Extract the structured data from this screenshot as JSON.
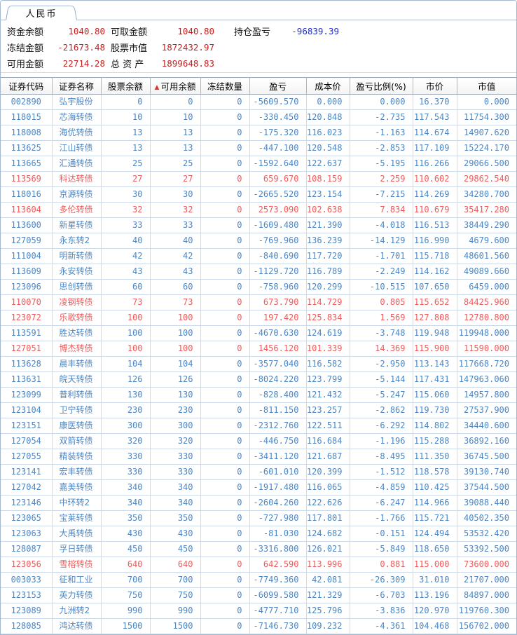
{
  "tab": {
    "label": "人民币"
  },
  "summary": {
    "funds_balance": {
      "label": "资金余额",
      "value": "1040.80"
    },
    "withdrawable": {
      "label": "可取金额",
      "value": "1040.80"
    },
    "position_pnl": {
      "label": "持仓盈亏",
      "value": "-96839.39"
    },
    "frozen_amount": {
      "label": "冻结金额",
      "value": "-21673.48"
    },
    "stock_market_value": {
      "label": "股票市值",
      "value": "1872432.97"
    },
    "available_amount": {
      "label": "可用金额",
      "value": "22714.28"
    },
    "total_assets": {
      "label": "总 资 产",
      "value": "1899648.83"
    }
  },
  "colors": {
    "row_positive": "#f05a5a",
    "row_negative": "#4d86c2",
    "summary_value": "#c32222",
    "summary_pnl": "#2230cc",
    "sort_arrow": "#e23030"
  },
  "table": {
    "sort_icon": "up-triangle-icon",
    "sorted_column_index": 3,
    "sort_arrow_glyph": "▲",
    "columns": [
      "证券代码",
      "证券名称",
      "股票余额",
      "可用余额",
      "冻结数量",
      "盈亏",
      "成本价",
      "盈亏比例(%)",
      "市价",
      "市值"
    ],
    "rows": [
      [
        "002890",
        "弘宇股份",
        "0",
        "0",
        "0",
        "-5609.570",
        "0.000",
        "0.000",
        "16.370",
        "0.000",
        "blue"
      ],
      [
        "118015",
        "芯海转债",
        "10",
        "10",
        "0",
        "-330.450",
        "120.848",
        "-2.735",
        "117.543",
        "11754.300",
        "blue"
      ],
      [
        "118008",
        "海优转债",
        "13",
        "13",
        "0",
        "-175.320",
        "116.023",
        "-1.163",
        "114.674",
        "14907.620",
        "blue"
      ],
      [
        "113625",
        "江山转债",
        "13",
        "13",
        "0",
        "-447.100",
        "120.548",
        "-2.853",
        "117.109",
        "15224.170",
        "blue"
      ],
      [
        "113665",
        "汇通转债",
        "25",
        "25",
        "0",
        "-1592.640",
        "122.637",
        "-5.195",
        "116.266",
        "29066.500",
        "blue"
      ],
      [
        "113569",
        "科达转债",
        "27",
        "27",
        "0",
        "659.670",
        "108.159",
        "2.259",
        "110.602",
        "29862.540",
        "red"
      ],
      [
        "118016",
        "京源转债",
        "30",
        "30",
        "0",
        "-2665.520",
        "123.154",
        "-7.215",
        "114.269",
        "34280.700",
        "blue"
      ],
      [
        "113604",
        "多伦转债",
        "32",
        "32",
        "0",
        "2573.090",
        "102.638",
        "7.834",
        "110.679",
        "35417.280",
        "red"
      ],
      [
        "113600",
        "新星转债",
        "33",
        "33",
        "0",
        "-1609.480",
        "121.390",
        "-4.018",
        "116.513",
        "38449.290",
        "blue"
      ],
      [
        "127059",
        "永东转2",
        "40",
        "40",
        "0",
        "-769.960",
        "136.239",
        "-14.129",
        "116.990",
        "4679.600",
        "blue"
      ],
      [
        "111004",
        "明新转债",
        "42",
        "42",
        "0",
        "-840.690",
        "117.720",
        "-1.701",
        "115.718",
        "48601.560",
        "blue"
      ],
      [
        "113609",
        "永安转债",
        "43",
        "43",
        "0",
        "-1129.720",
        "116.789",
        "-2.249",
        "114.162",
        "49089.660",
        "blue"
      ],
      [
        "123096",
        "思创转债",
        "60",
        "60",
        "0",
        "-758.960",
        "120.299",
        "-10.515",
        "107.650",
        "6459.000",
        "blue"
      ],
      [
        "110070",
        "凌钢转债",
        "73",
        "73",
        "0",
        "673.790",
        "114.729",
        "0.805",
        "115.652",
        "84425.960",
        "red"
      ],
      [
        "123072",
        "乐歌转债",
        "100",
        "100",
        "0",
        "197.420",
        "125.834",
        "1.569",
        "127.808",
        "12780.800",
        "red"
      ],
      [
        "113591",
        "胜达转债",
        "100",
        "100",
        "0",
        "-4670.630",
        "124.619",
        "-3.748",
        "119.948",
        "119948.000",
        "blue"
      ],
      [
        "127051",
        "博杰转债",
        "100",
        "100",
        "0",
        "1456.120",
        "101.339",
        "14.369",
        "115.900",
        "11590.000",
        "red"
      ],
      [
        "113628",
        "晨丰转债",
        "104",
        "104",
        "0",
        "-3577.040",
        "116.582",
        "-2.950",
        "113.143",
        "117668.720",
        "blue"
      ],
      [
        "113631",
        "皖天转债",
        "126",
        "126",
        "0",
        "-8024.220",
        "123.799",
        "-5.144",
        "117.431",
        "147963.060",
        "blue"
      ],
      [
        "123099",
        "普利转债",
        "130",
        "130",
        "0",
        "-828.400",
        "121.432",
        "-5.247",
        "115.060",
        "14957.800",
        "blue"
      ],
      [
        "123104",
        "卫宁转债",
        "230",
        "230",
        "0",
        "-811.150",
        "123.257",
        "-2.862",
        "119.730",
        "27537.900",
        "blue"
      ],
      [
        "123151",
        "康医转债",
        "300",
        "300",
        "0",
        "-2312.760",
        "122.511",
        "-6.292",
        "114.802",
        "34440.600",
        "blue"
      ],
      [
        "127054",
        "双箭转债",
        "320",
        "320",
        "0",
        "-446.750",
        "116.684",
        "-1.196",
        "115.288",
        "36892.160",
        "blue"
      ],
      [
        "127055",
        "精装转债",
        "330",
        "330",
        "0",
        "-3411.120",
        "121.687",
        "-8.495",
        "111.350",
        "36745.500",
        "blue"
      ],
      [
        "123141",
        "宏丰转债",
        "330",
        "330",
        "0",
        "-601.010",
        "120.399",
        "-1.512",
        "118.578",
        "39130.740",
        "blue"
      ],
      [
        "127042",
        "嘉美转债",
        "340",
        "340",
        "0",
        "-1917.480",
        "116.065",
        "-4.859",
        "110.425",
        "37544.500",
        "blue"
      ],
      [
        "123146",
        "中环转2",
        "340",
        "340",
        "0",
        "-2604.260",
        "122.626",
        "-6.247",
        "114.966",
        "39088.440",
        "blue"
      ],
      [
        "123065",
        "宝莱转债",
        "350",
        "350",
        "0",
        "-727.980",
        "117.801",
        "-1.766",
        "115.721",
        "40502.350",
        "blue"
      ],
      [
        "123063",
        "大禹转债",
        "430",
        "430",
        "0",
        "-81.030",
        "124.682",
        "-0.151",
        "124.494",
        "53532.420",
        "blue"
      ],
      [
        "128087",
        "孚日转债",
        "450",
        "450",
        "0",
        "-3316.800",
        "126.021",
        "-5.849",
        "118.650",
        "53392.500",
        "blue"
      ],
      [
        "123056",
        "雪榕转债",
        "640",
        "640",
        "0",
        "642.590",
        "113.996",
        "0.881",
        "115.000",
        "73600.000",
        "red"
      ],
      [
        "003033",
        "征和工业",
        "700",
        "700",
        "0",
        "-7749.360",
        "42.081",
        "-26.309",
        "31.010",
        "21707.000",
        "blue"
      ],
      [
        "123153",
        "英力转债",
        "750",
        "750",
        "0",
        "-6099.580",
        "121.329",
        "-6.703",
        "113.196",
        "84897.000",
        "blue"
      ],
      [
        "123089",
        "九洲转2",
        "990",
        "990",
        "0",
        "-4777.710",
        "125.796",
        "-3.836",
        "120.970",
        "119760.300",
        "blue"
      ],
      [
        "128085",
        "鸿达转债",
        "1500",
        "1500",
        "0",
        "-7146.730",
        "109.232",
        "-4.361",
        "104.468",
        "156702.000",
        "blue"
      ]
    ]
  }
}
